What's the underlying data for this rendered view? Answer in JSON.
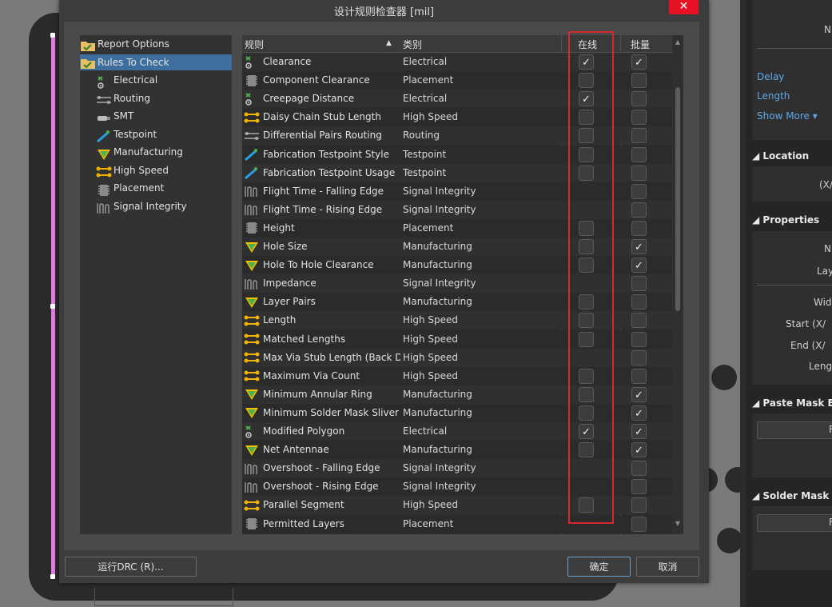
{
  "dialog": {
    "title": "设计规则检查器 [mil]",
    "close_glyph": "✕",
    "run_drc_label": "运行DRC (R)...",
    "ok_label": "确定",
    "cancel_label": "取消"
  },
  "tree": {
    "items": [
      {
        "label": "Report Options",
        "icon": "folder-check-icon",
        "level": 0,
        "selected": false
      },
      {
        "label": "Rules To Check",
        "icon": "folder-check-icon",
        "level": 0,
        "selected": true
      },
      {
        "label": "Electrical",
        "icon": "electrical-icon",
        "level": 1,
        "selected": false
      },
      {
        "label": "Routing",
        "icon": "routing-icon",
        "level": 1,
        "selected": false
      },
      {
        "label": "SMT",
        "icon": "smt-icon",
        "level": 1,
        "selected": false
      },
      {
        "label": "Testpoint",
        "icon": "testpoint-icon",
        "level": 1,
        "selected": false
      },
      {
        "label": "Manufacturing",
        "icon": "manufacturing-icon",
        "level": 1,
        "selected": false
      },
      {
        "label": "High Speed",
        "icon": "high-speed-icon",
        "level": 1,
        "selected": false
      },
      {
        "label": "Placement",
        "icon": "placement-icon",
        "level": 1,
        "selected": false
      },
      {
        "label": "Signal Integrity",
        "icon": "signal-integrity-icon",
        "level": 1,
        "selected": false
      }
    ]
  },
  "grid": {
    "headers": {
      "rule": "规则",
      "category": "类别",
      "online": "在线",
      "batch": "批量"
    },
    "rows": [
      {
        "name": "Clearance",
        "category": "Electrical",
        "icon": "electrical",
        "online": true,
        "batch": true,
        "has_online": true
      },
      {
        "name": "Component Clearance",
        "category": "Placement",
        "icon": "placement",
        "online": false,
        "batch": false,
        "has_online": true
      },
      {
        "name": "Creepage Distance",
        "category": "Electrical",
        "icon": "electrical",
        "online": true,
        "batch": false,
        "has_online": true
      },
      {
        "name": "Daisy Chain Stub Length",
        "category": "High Speed",
        "icon": "highspeed",
        "online": false,
        "batch": false,
        "has_online": true
      },
      {
        "name": "Differential Pairs Routing",
        "category": "Routing",
        "icon": "routing",
        "online": false,
        "batch": false,
        "has_online": true
      },
      {
        "name": "Fabrication Testpoint Style",
        "category": "Testpoint",
        "icon": "testpoint",
        "online": false,
        "batch": false,
        "has_online": true
      },
      {
        "name": "Fabrication Testpoint Usage",
        "category": "Testpoint",
        "icon": "testpoint",
        "online": false,
        "batch": false,
        "has_online": true
      },
      {
        "name": "Flight Time - Falling Edge",
        "category": "Signal Integrity",
        "icon": "signal",
        "online": false,
        "batch": false,
        "has_online": false
      },
      {
        "name": "Flight Time - Rising Edge",
        "category": "Signal Integrity",
        "icon": "signal",
        "online": false,
        "batch": false,
        "has_online": false
      },
      {
        "name": "Height",
        "category": "Placement",
        "icon": "placement",
        "online": false,
        "batch": false,
        "has_online": true
      },
      {
        "name": "Hole Size",
        "category": "Manufacturing",
        "icon": "manufacturing",
        "online": false,
        "batch": true,
        "has_online": true
      },
      {
        "name": "Hole To Hole Clearance",
        "category": "Manufacturing",
        "icon": "manufacturing",
        "online": false,
        "batch": true,
        "has_online": true
      },
      {
        "name": "Impedance",
        "category": "Signal Integrity",
        "icon": "signal",
        "online": false,
        "batch": false,
        "has_online": false
      },
      {
        "name": "Layer Pairs",
        "category": "Manufacturing",
        "icon": "manufacturing",
        "online": false,
        "batch": false,
        "has_online": true
      },
      {
        "name": "Length",
        "category": "High Speed",
        "icon": "highspeed",
        "online": false,
        "batch": false,
        "has_online": true
      },
      {
        "name": "Matched Lengths",
        "category": "High Speed",
        "icon": "highspeed",
        "online": false,
        "batch": false,
        "has_online": true
      },
      {
        "name": "Max Via Stub Length (Back Drilling)",
        "category": "High Speed",
        "icon": "highspeed",
        "online": false,
        "batch": false,
        "has_online": false
      },
      {
        "name": "Maximum Via Count",
        "category": "High Speed",
        "icon": "highspeed",
        "online": false,
        "batch": false,
        "has_online": true
      },
      {
        "name": "Minimum Annular Ring",
        "category": "Manufacturing",
        "icon": "manufacturing",
        "online": false,
        "batch": true,
        "has_online": true
      },
      {
        "name": "Minimum Solder Mask Sliver",
        "category": "Manufacturing",
        "icon": "manufacturing",
        "online": false,
        "batch": true,
        "has_online": true
      },
      {
        "name": "Modified Polygon",
        "category": "Electrical",
        "icon": "electrical",
        "online": true,
        "batch": true,
        "has_online": true
      },
      {
        "name": "Net Antennae",
        "category": "Manufacturing",
        "icon": "manufacturing",
        "online": false,
        "batch": true,
        "has_online": true
      },
      {
        "name": "Overshoot - Falling Edge",
        "category": "Signal Integrity",
        "icon": "signal",
        "online": false,
        "batch": false,
        "has_online": false
      },
      {
        "name": "Overshoot - Rising Edge",
        "category": "Signal Integrity",
        "icon": "signal",
        "online": false,
        "batch": false,
        "has_online": false
      },
      {
        "name": "Parallel Segment",
        "category": "High Speed",
        "icon": "highspeed",
        "online": false,
        "batch": false,
        "has_online": true
      },
      {
        "name": "Permitted Layers",
        "category": "Placement",
        "icon": "placement",
        "online": false,
        "batch": false,
        "has_online": false
      }
    ]
  },
  "panel": {
    "n_label": "N",
    "delay": "Delay",
    "length": "Length",
    "show_more": "Show More ▾",
    "location_header": "Location",
    "xy_label": "(X/",
    "properties_header": "Properties",
    "prop_n": "N",
    "layer": "Lay",
    "width": "Wid",
    "start": "Start (X/",
    "end": "End (X/",
    "lengthlbl": "Lengt",
    "paste_header": "Paste Mask Expa",
    "solder_header": "Solder Mask Exp",
    "btn1": "F",
    "btn2": "F"
  },
  "colors": {
    "accent": "#3e6e9e",
    "highlight_box": "#d8282f",
    "link": "#5fa8e8",
    "close": "#e81123"
  }
}
